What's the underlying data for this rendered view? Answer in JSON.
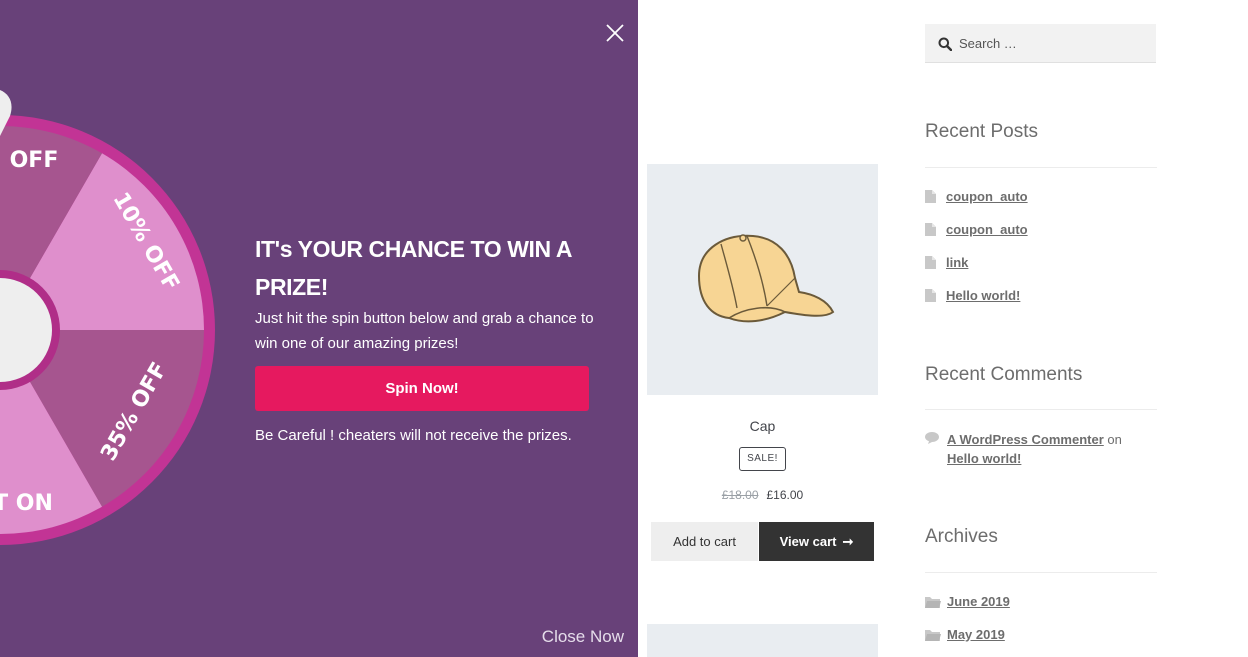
{
  "popup": {
    "headline": "IT's YOUR CHANCE TO WIN A PRIZE!",
    "description": "Just hit the spin button below and grab a chance to win one of our amazing prizes!",
    "spin_button": "Spin Now!",
    "warning": "Be Careful ! cheaters will not receive the prizes.",
    "close_now": "Close Now",
    "wheel_slices": [
      {
        "label": "OFF",
        "color": "#a6558f"
      },
      {
        "label": "10% OFF",
        "color": "#df8fcc"
      },
      {
        "label": "35% OFF",
        "color": "#a6558f"
      },
      {
        "label": "T ON",
        "color": "#df8fcc"
      }
    ],
    "colors": {
      "background": "#684179",
      "button": "#e6195f",
      "wheel_rim": "#c23495"
    }
  },
  "product": {
    "title": "Cap",
    "sale_badge": "SALE!",
    "old_price": "£18.00",
    "new_price": "£16.00",
    "add_to_cart": "Add to cart",
    "view_cart": "View cart"
  },
  "sidebar": {
    "search_placeholder": "Search …",
    "recent_posts_title": "Recent Posts",
    "recent_posts": [
      "coupon_auto",
      "coupon_auto",
      "link",
      "Hello world!"
    ],
    "recent_comments_title": "Recent Comments",
    "comment": {
      "author": "A WordPress Commenter",
      "on": "on",
      "post": "Hello world!"
    },
    "archives_title": "Archives",
    "archives": [
      "June 2019",
      "May 2019"
    ]
  }
}
